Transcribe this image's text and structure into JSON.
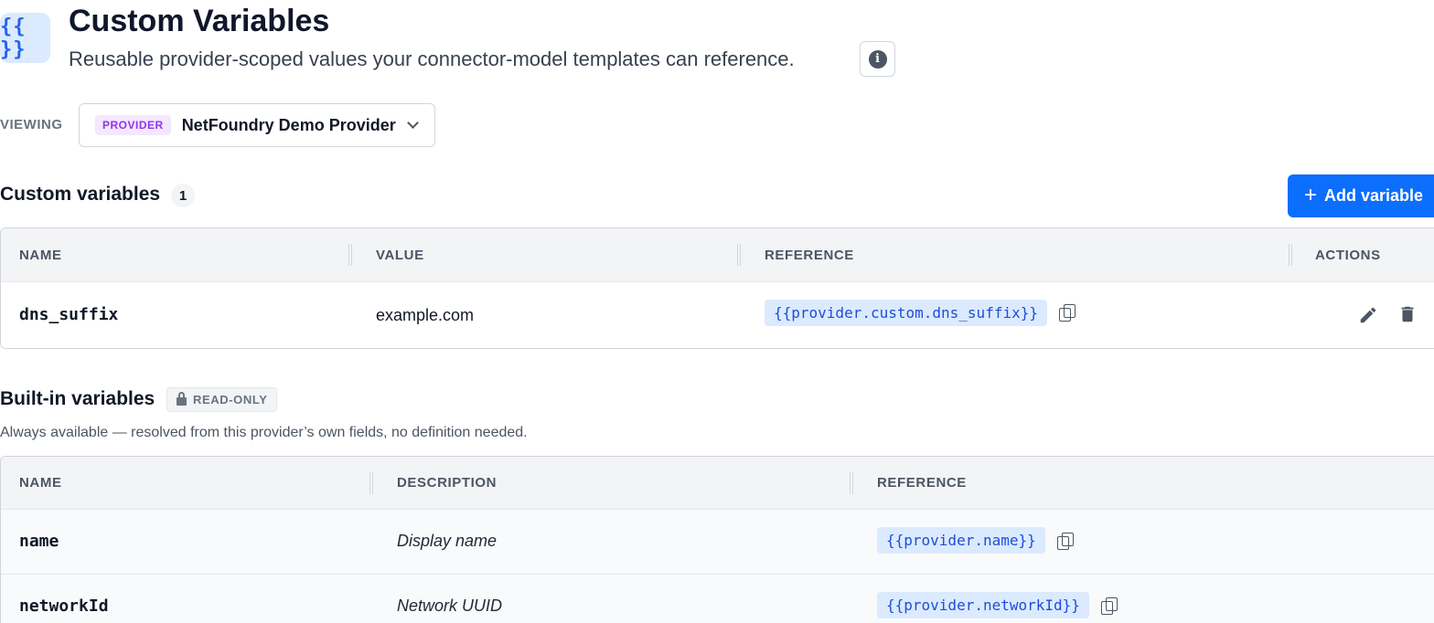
{
  "header": {
    "icon_text": "{{ }}",
    "title": "Custom Variables",
    "subtitle": "Reusable provider-scoped values your connector-model templates can reference.",
    "info_icon_glyph": "i"
  },
  "viewing": {
    "label": "VIEWING",
    "badge": "PROVIDER",
    "provider_name": "NetFoundry Demo Provider"
  },
  "custom_section": {
    "title": "Custom variables",
    "count": "1",
    "add_button_label": "Add variable",
    "columns": [
      "NAME",
      "VALUE",
      "REFERENCE",
      "ACTIONS"
    ],
    "rows": [
      {
        "name": "dns_suffix",
        "value": "example.com",
        "reference": "{{provider.custom.dns_suffix}}"
      }
    ]
  },
  "builtin_section": {
    "title": "Built-in variables",
    "badge": "READ-ONLY",
    "description": "Always available — resolved from this provider’s own fields, no definition needed.",
    "columns": [
      "NAME",
      "DESCRIPTION",
      "REFERENCE"
    ],
    "rows": [
      {
        "name": "name",
        "description": "Display name",
        "reference": "{{provider.name}}"
      },
      {
        "name": "networkId",
        "description": "Network UUID",
        "reference": "{{provider.networkId}}"
      }
    ]
  },
  "colors": {
    "accent": "#0b6efd",
    "chip_bg": "#dbeafe",
    "chip_text": "#1d4ed8",
    "provider_badge_bg": "#f3e8ff",
    "provider_badge_text": "#9333ea"
  }
}
